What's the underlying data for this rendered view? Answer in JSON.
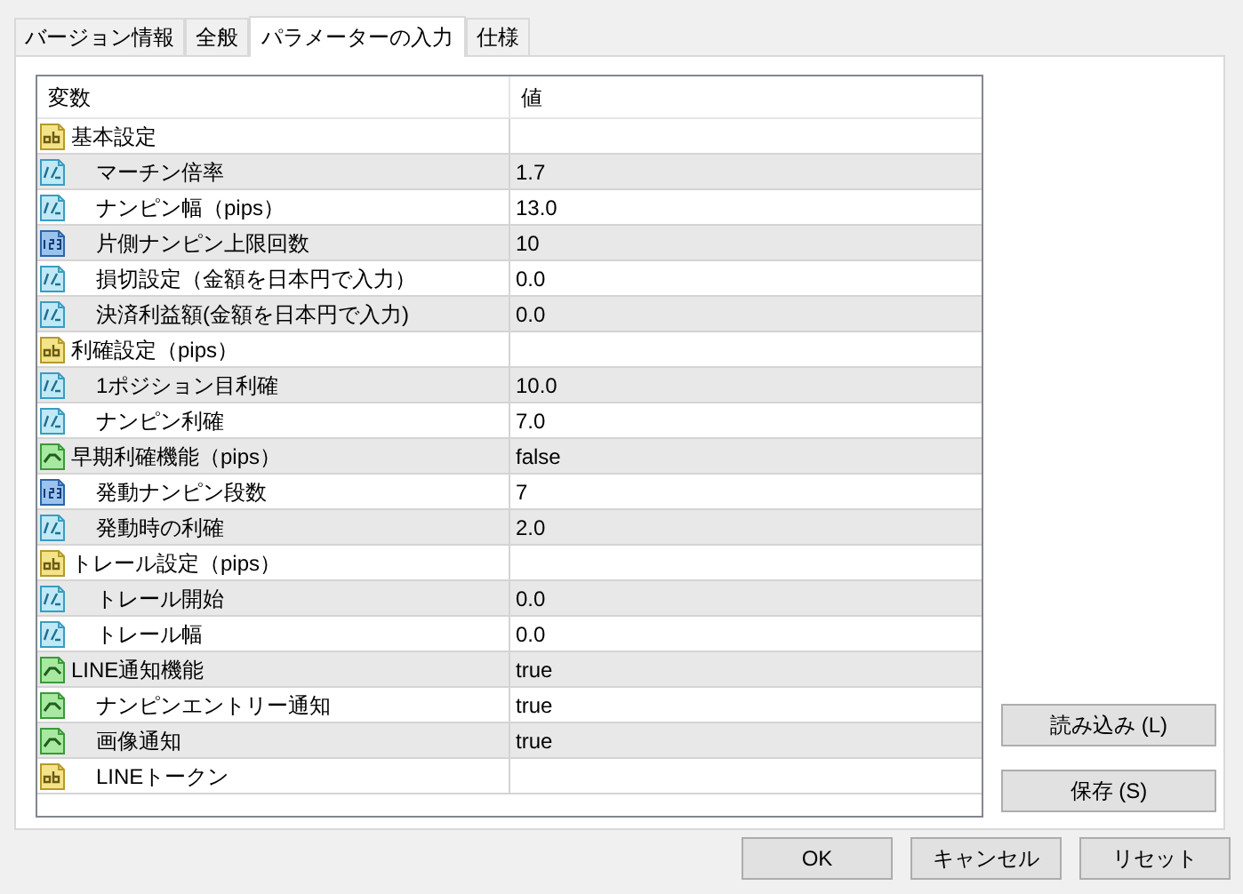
{
  "tabs": [
    {
      "label": "バージョン情報",
      "selected": false
    },
    {
      "label": "全般",
      "selected": false
    },
    {
      "label": "パラメーターの入力",
      "selected": true
    },
    {
      "label": "仕様",
      "selected": false
    }
  ],
  "table": {
    "columns": [
      "変数",
      "値"
    ],
    "rows": [
      {
        "kind": "string",
        "name": "基本設定",
        "children": [
          {
            "kind": "double",
            "name": "マーチン倍率",
            "value": "1.7"
          },
          {
            "kind": "double",
            "name": "ナンピン幅（pips）",
            "value": "13.0"
          },
          {
            "kind": "int",
            "name": "片側ナンピン上限回数",
            "value": "10"
          },
          {
            "kind": "double",
            "name": "損切設定（金額を日本円で入力）",
            "value": "0.0"
          },
          {
            "kind": "double",
            "name": "決済利益額(金額を日本円で入力)",
            "value": "0.0"
          }
        ]
      },
      {
        "kind": "string",
        "name": "利確設定（pips）",
        "children": [
          {
            "kind": "double",
            "name": "1ポジション目利確",
            "value": "10.0"
          },
          {
            "kind": "double",
            "name": "ナンピン利確",
            "value": "7.0"
          }
        ]
      },
      {
        "kind": "bool",
        "name": "早期利確機能（pips）",
        "value": "false",
        "children": [
          {
            "kind": "int",
            "name": "発動ナンピン段数",
            "value": "7"
          },
          {
            "kind": "double",
            "name": "発動時の利確",
            "value": "2.0"
          }
        ]
      },
      {
        "kind": "string",
        "name": "トレール設定（pips）",
        "children": [
          {
            "kind": "double",
            "name": "トレール開始",
            "value": "0.0"
          },
          {
            "kind": "double",
            "name": "トレール幅",
            "value": "0.0"
          }
        ]
      },
      {
        "kind": "bool",
        "name": "LINE通知機能",
        "value": "true",
        "children": [
          {
            "kind": "bool",
            "name": "ナンピンエントリー通知",
            "value": "true"
          },
          {
            "kind": "bool",
            "name": "画像通知",
            "value": "true"
          },
          {
            "kind": "string",
            "name": "LINEトークン"
          }
        ]
      }
    ]
  },
  "side_buttons": [
    "読み込み (L)",
    "保存 (S)"
  ],
  "buttons": [
    "OK",
    "キャンセル",
    "リセット"
  ]
}
